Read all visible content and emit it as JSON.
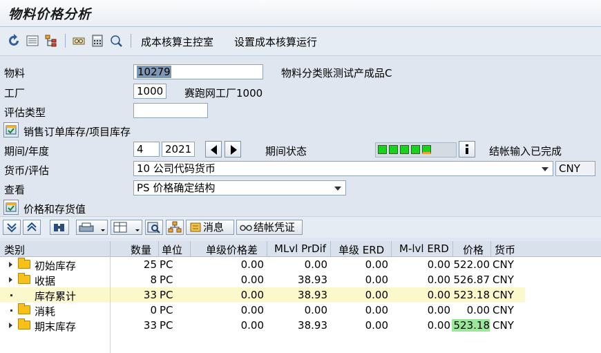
{
  "window": {
    "title": "物料价格分析"
  },
  "toolbar": {
    "menu1": "成本核算主控室",
    "menu2": "设置成本核算运行"
  },
  "header": {
    "material_label": "物料",
    "material_value": "10279",
    "material_desc": "物料分类账测试产成品C",
    "plant_label": "工厂",
    "plant_value": "1000",
    "plant_desc": "赛跑网工厂1000",
    "valtype_label": "评估类型",
    "valtype_value": "",
    "sales_stock_label": "销售订单库存/项目库存",
    "period_label": "期间/年度",
    "period_value": "4",
    "year_value": "2021",
    "period_status_label": "期间状态",
    "period_status_text": "结帐输入已完成",
    "currency_label": "货币/评估",
    "currency_value": "10 公司代码货币",
    "currency_code": "CNY",
    "view_label": "查看",
    "view_value": "PS 价格确定结构",
    "price_stock_label": "价格和存货值"
  },
  "alv_toolbar": {
    "messages": "消息",
    "closing_doc": "结帐凭证"
  },
  "table": {
    "headers": {
      "category": "类别",
      "qty": "数量",
      "unit": "单位",
      "single_diff": "单级价格差",
      "mlvl_prdif": "MLvl PrDif",
      "single_erd": "单级 ERD",
      "mlvl_erd": "M-lvl ERD",
      "price": "价格",
      "currency": "货币"
    },
    "rows": [
      {
        "category": "初始库存",
        "qty": "25",
        "unit": "PC",
        "single_diff": "0.00",
        "mlvl_prdif": "0.00",
        "single_erd": "0.00",
        "mlvl_erd": "0.00",
        "price": "522.00",
        "currency": "CNY"
      },
      {
        "category": "收据",
        "qty": "8",
        "unit": "PC",
        "single_diff": "0.00",
        "mlvl_prdif": "38.93",
        "single_erd": "0.00",
        "mlvl_erd": "0.00",
        "price": "526.87",
        "currency": "CNY"
      },
      {
        "category": "库存累计",
        "qty": "33",
        "unit": "PC",
        "single_diff": "0.00",
        "mlvl_prdif": "38.93",
        "single_erd": "0.00",
        "mlvl_erd": "0.00",
        "price": "523.18",
        "currency": "CNY"
      },
      {
        "category": "消耗",
        "qty": "0",
        "unit": "PC",
        "single_diff": "0.00",
        "mlvl_prdif": "0.00",
        "single_erd": "0.00",
        "mlvl_erd": "0.00",
        "price": "0.00",
        "currency": "CNY"
      },
      {
        "category": "期末库存",
        "qty": "33",
        "unit": "PC",
        "single_diff": "0.00",
        "mlvl_prdif": "38.93",
        "single_erd": "0.00",
        "mlvl_erd": "0.00",
        "price": "523.18",
        "currency": "CNY"
      }
    ]
  },
  "colors": {
    "highlight_row": "#fbf8cc",
    "price_highlight": "#9be89b",
    "led_green": "#18d21c"
  }
}
